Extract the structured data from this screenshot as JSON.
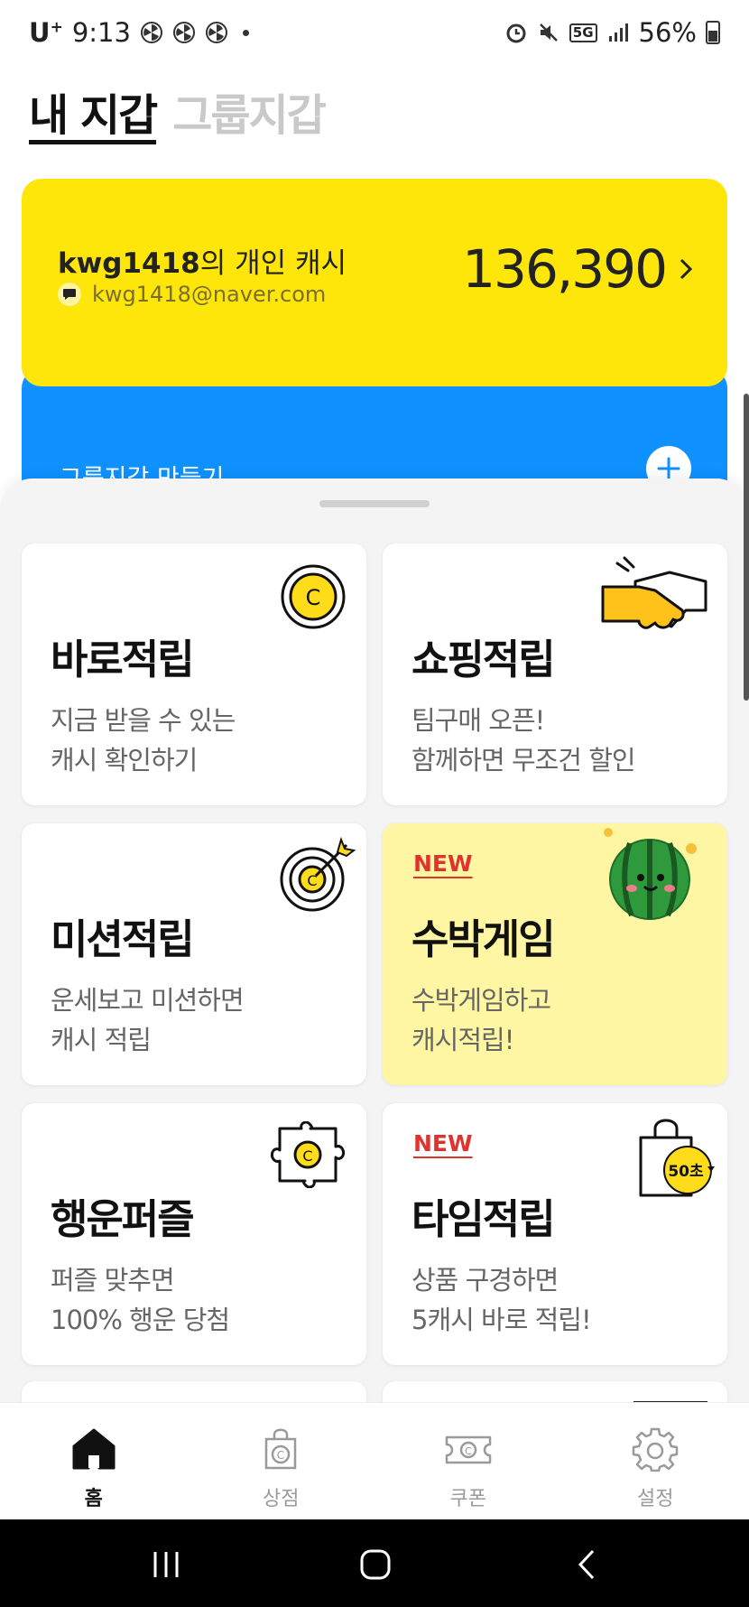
{
  "status_bar": {
    "carrier": "U",
    "carrier_sup": "+",
    "time": "9:13",
    "network": "5G",
    "battery": "56%"
  },
  "wallet_tabs": [
    {
      "label": "내 지갑",
      "active": true
    },
    {
      "label": "그룹지갑",
      "active": false
    }
  ],
  "cash_card": {
    "owner_id": "kwg1418",
    "owner_suffix": "의 개인 캐시",
    "email": "kwg1418@naver.com",
    "amount": "136,390",
    "color": "#ffe60a"
  },
  "group_card": {
    "label": "그룹지갑 만들기",
    "color": "#0f91ff"
  },
  "tiles": [
    {
      "title": "바로적립",
      "desc_line1": "지금 받을 수 있는",
      "desc_line2": "캐시 확인하기",
      "icon": "coin-icon"
    },
    {
      "title": "쇼핑적립",
      "desc_line1": "팀구매 오픈!",
      "desc_line2": "함께하면 무조건 할인",
      "icon": "handshake-icon"
    },
    {
      "title": "미션적립",
      "desc_line1": "운세보고 미션하면",
      "desc_line2": "캐시 적립",
      "icon": "target-icon"
    },
    {
      "title": "수박게임",
      "desc_line1": "수박게임하고",
      "desc_line2": "캐시적립!",
      "badge": "NEW",
      "icon": "watermelon-icon"
    },
    {
      "title": "행운퍼즐",
      "desc_line1": "퍼즐 맞추면",
      "desc_line2": "100% 행운 당첨",
      "icon": "puzzle-icon"
    },
    {
      "title": "타임적립",
      "desc_line1": "상품 구경하면",
      "desc_line2": "5캐시 바로 적립!",
      "badge": "NEW",
      "icon": "shopping-bag-timer-icon",
      "icon_text": "50초"
    }
  ],
  "bottom_nav": [
    {
      "label": "홈",
      "icon": "home-icon",
      "active": true
    },
    {
      "label": "상점",
      "icon": "store-icon",
      "active": false
    },
    {
      "label": "쿠폰",
      "icon": "coupon-icon",
      "active": false
    },
    {
      "label": "설정",
      "icon": "settings-icon",
      "active": false
    }
  ],
  "colors": {
    "accent_yellow": "#ffe60a",
    "accent_blue": "#0f91ff",
    "new_badge": "#e0322f",
    "tile_highlight": "#fff6a3"
  }
}
